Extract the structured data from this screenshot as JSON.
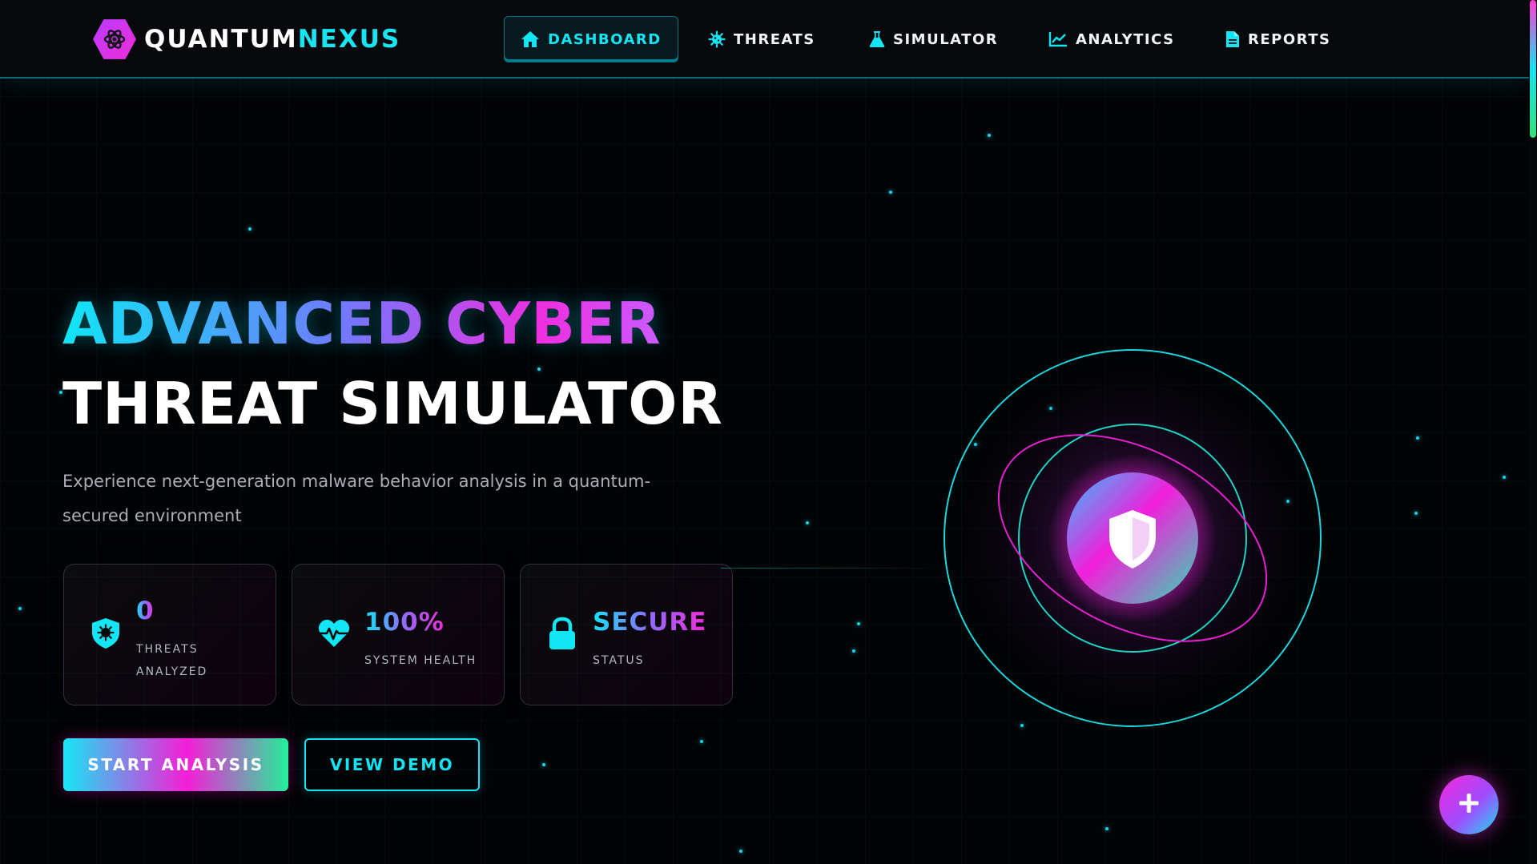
{
  "brand": {
    "name_part1": "QUANTUM",
    "name_part2": "NEXUS",
    "logo_icon": "atom-icon"
  },
  "nav": [
    {
      "label": "DASHBOARD",
      "icon": "home-icon",
      "active": true
    },
    {
      "label": "THREATS",
      "icon": "virus-icon",
      "active": false
    },
    {
      "label": "SIMULATOR",
      "icon": "flask-icon",
      "active": false
    },
    {
      "label": "ANALYTICS",
      "icon": "chart-line-icon",
      "active": false
    },
    {
      "label": "REPORTS",
      "icon": "file-icon",
      "active": false
    }
  ],
  "hero": {
    "title_line1": "ADVANCED CYBER",
    "title_line2": "THREAT SIMULATOR",
    "subtitle": "Experience next-generation malware behavior analysis in a quantum-secured environment"
  },
  "stats": [
    {
      "value": "0",
      "label": "THREATS ANALYZED",
      "icon": "shield-virus-icon"
    },
    {
      "value": "100%",
      "label": "SYSTEM HEALTH",
      "icon": "heart-pulse-icon"
    },
    {
      "value": "SECURE",
      "label": "STATUS",
      "icon": "lock-icon"
    }
  ],
  "actions": {
    "primary_label": "START ANALYSIS",
    "secondary_label": "VIEW DEMO"
  },
  "orb": {
    "icon": "shield-icon"
  },
  "fab": {
    "label": "+",
    "icon": "plus-icon"
  },
  "colors": {
    "cyan": "#12e6f5",
    "magenta": "#f02cd6",
    "green": "#23f09a",
    "background": "#020305"
  }
}
